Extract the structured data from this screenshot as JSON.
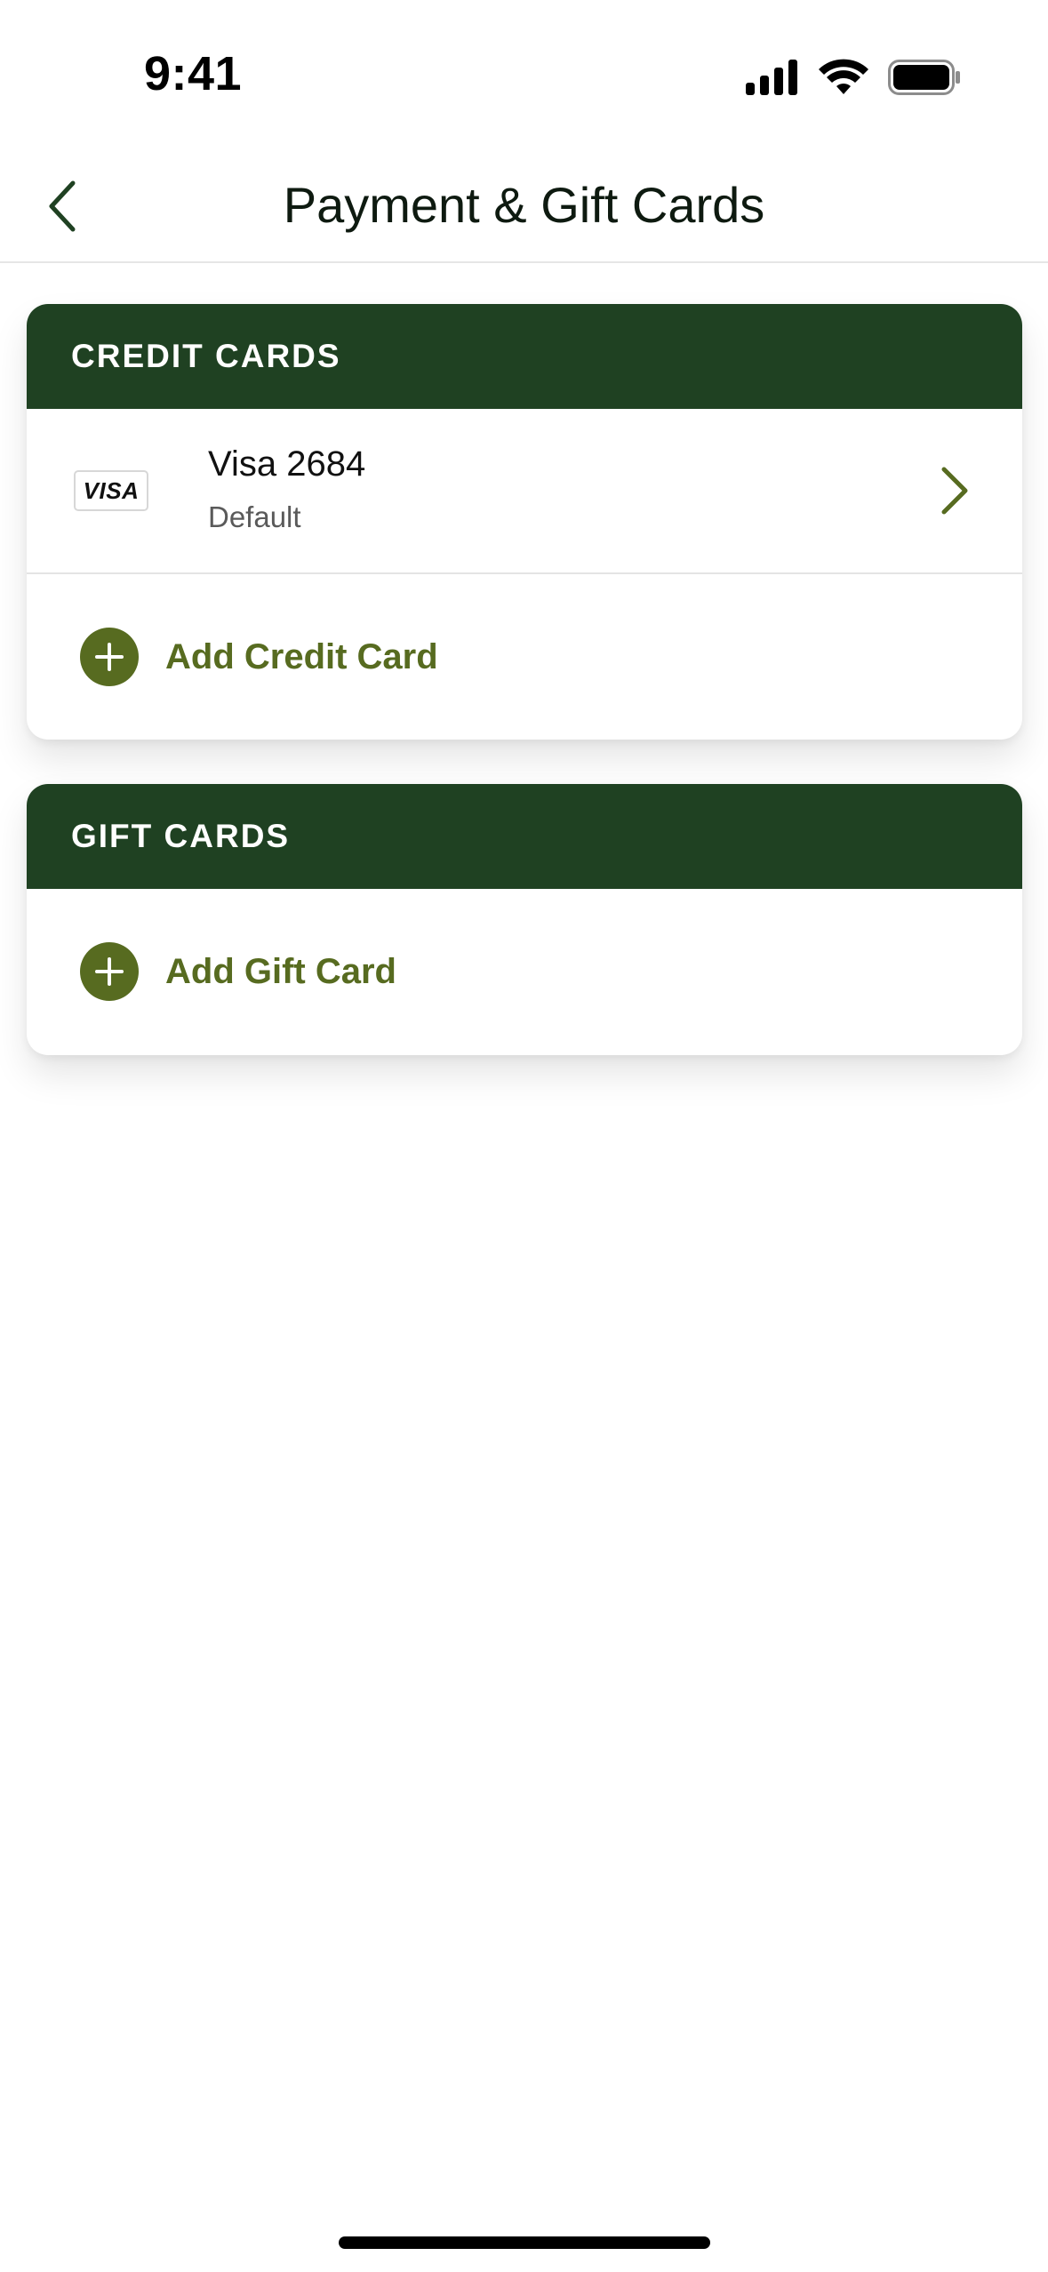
{
  "status_bar": {
    "time": "9:41"
  },
  "header": {
    "title": "Payment & Gift Cards"
  },
  "credit_cards": {
    "heading": "CREDIT CARDS",
    "cards": [
      {
        "brand_logo_text": "VISA",
        "name": "Visa 2684",
        "subtitle": "Default"
      }
    ],
    "add_label": "Add Credit Card"
  },
  "gift_cards": {
    "heading": "GIFT CARDS",
    "add_label": "Add Gift Card"
  },
  "colors": {
    "header_green": "#1f4122",
    "accent_olive": "#576b20"
  }
}
